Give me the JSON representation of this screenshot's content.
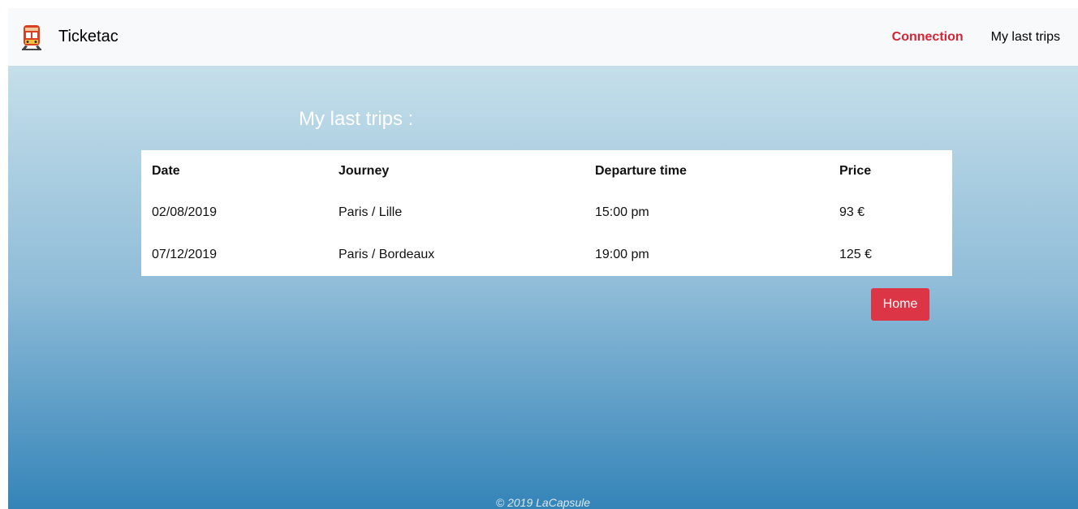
{
  "navbar": {
    "brand_icon": "train-icon",
    "brand_name": "Ticketac",
    "links": {
      "connection": "Connection",
      "last_trips": "My last trips"
    }
  },
  "main": {
    "title": "My last trips :",
    "table": {
      "headers": {
        "date": "Date",
        "journey": "Journey",
        "departure": "Departure time",
        "price": "Price"
      },
      "rows": [
        {
          "date": "02/08/2019",
          "journey": "Paris / Lille",
          "departure": "15:00 pm",
          "price": "93 €"
        },
        {
          "date": "07/12/2019",
          "journey": "Paris / Bordeaux",
          "departure": "19:00 pm",
          "price": "125 €"
        }
      ]
    },
    "home_button": "Home"
  },
  "footer": {
    "text": "© 2019 LaCapsule"
  },
  "colors": {
    "accent_red": "#dc3545",
    "connection_red": "#d32535",
    "navbar_bg": "#f8f9fa",
    "gradient_top": "#c5dfea",
    "gradient_bottom": "#3484b8"
  }
}
